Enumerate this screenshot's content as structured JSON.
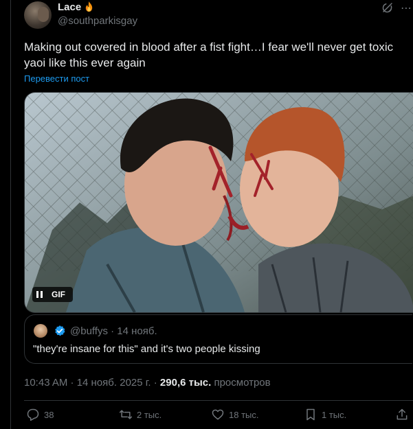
{
  "author": {
    "name": "Lace",
    "handle": "@southparkisgay",
    "badge_icon": "fire-emoji-icon"
  },
  "header_icons": [
    "grok-icon",
    "more-options-icon"
  ],
  "tweet": {
    "text": "Making out covered in blood after a fist fight…I fear we'll never get toxic yaoi like this ever again",
    "translate_label": "Перевести пост"
  },
  "media": {
    "badge_label": "GIF",
    "pause_icon": "pause-icon"
  },
  "quote": {
    "handle_date": "@buffys · 14 нояб.",
    "text": "\"they're insane for this\" and it's two people kissing",
    "verified_icon": "verified-badge-icon"
  },
  "meta": {
    "timestamp": "10:43 AM · 14 нояб. 2025 г. · ",
    "views_count": "290,6 тыс.",
    "views_label": " просмотров"
  },
  "actions": {
    "replies": "38",
    "reposts": "2 тыс.",
    "likes": "18 тыс.",
    "bookmarks": "1 тыс."
  },
  "colors": {
    "background": "#000000",
    "text_primary": "#e7e9ea",
    "text_secondary": "#71767b",
    "accent": "#1d9bf0",
    "border": "#2f3336"
  }
}
